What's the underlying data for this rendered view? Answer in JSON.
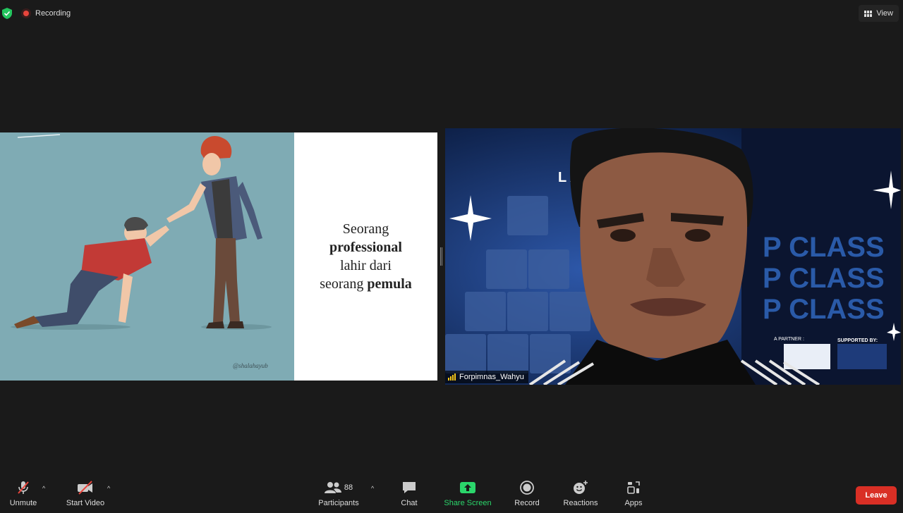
{
  "topbar": {
    "recording_label": "Recording",
    "view_label": "View"
  },
  "slide": {
    "line1": "Seorang",
    "line2": "professional",
    "line3": "lahir dari",
    "line4_prefix": "seorang ",
    "line4_bold": "pemula",
    "watermark": "@shalahayub"
  },
  "camera": {
    "participant_name": "Forpimnas_Wahyu",
    "bg_heading": "L      ASS",
    "bg_repeat": [
      "P CLASS",
      "P CLASS",
      "P CLASS"
    ],
    "partner_label": "A PARTNER :",
    "supported_label": "SUPPORTED BY:"
  },
  "toolbar": {
    "unmute": "Unmute",
    "start_video": "Start Video",
    "participants": "Participants",
    "participants_count": "88",
    "chat": "Chat",
    "share_screen": "Share Screen",
    "record": "Record",
    "reactions": "Reactions",
    "apps": "Apps",
    "leave": "Leave"
  },
  "colors": {
    "background": "#1a1a1a",
    "share_green": "#2bd66b",
    "leave_red": "#d92f25",
    "recording_red": "#e8453c",
    "security_green": "#23c55e"
  },
  "icons": [
    "shield-check-icon",
    "recording-dot-icon",
    "view-grid-icon",
    "mic-muted-icon",
    "video-off-icon",
    "participants-icon",
    "chat-icon",
    "share-screen-icon",
    "record-icon",
    "reactions-icon",
    "apps-icon",
    "signal-bars-icon"
  ]
}
